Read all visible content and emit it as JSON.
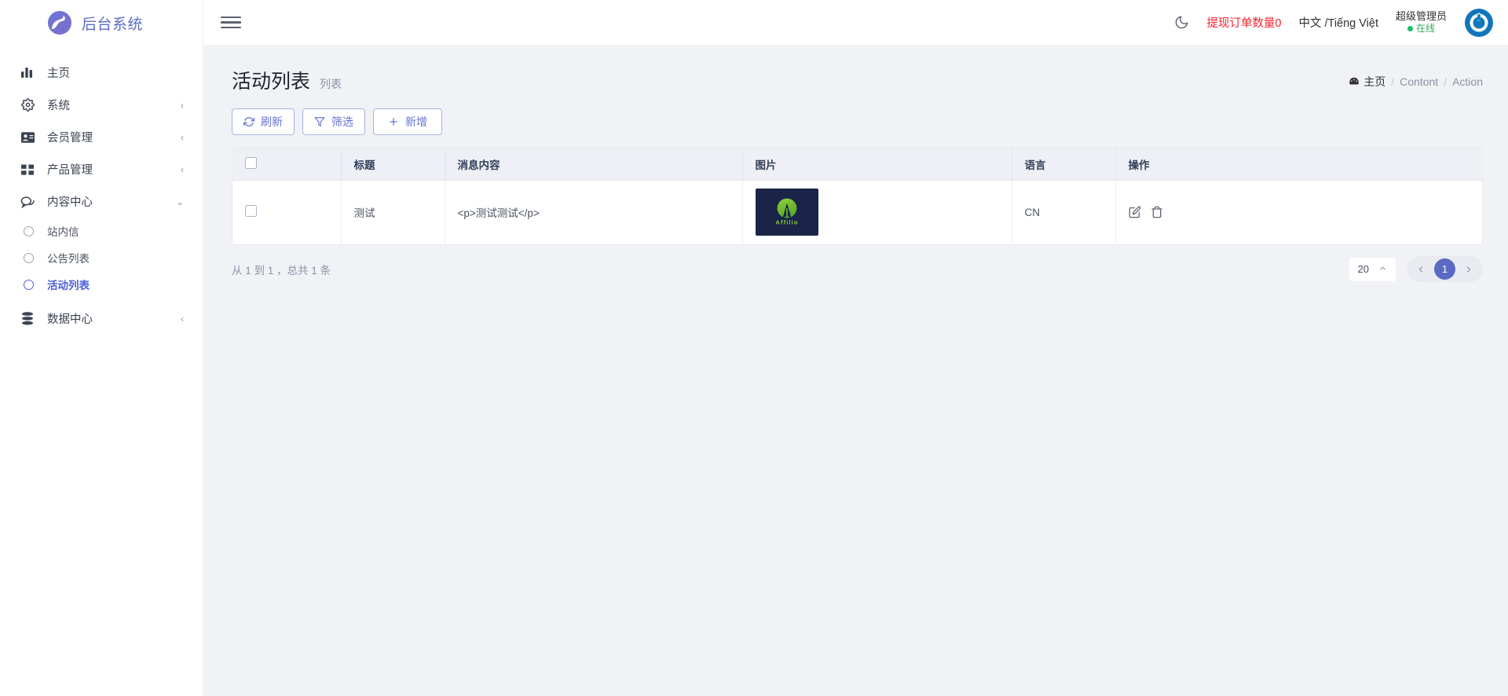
{
  "brand": {
    "title": "后台系统",
    "logo_icon": "swoosh-circle-logo"
  },
  "sidebar": {
    "items": [
      {
        "label": "主页",
        "icon": "bar-chart-icon",
        "arrow": ""
      },
      {
        "label": "系统",
        "icon": "gear-icon",
        "arrow": "‹"
      },
      {
        "label": "会员管理",
        "icon": "id-card-icon",
        "arrow": "‹"
      },
      {
        "label": "产品管理",
        "icon": "grid-icon",
        "arrow": "‹"
      },
      {
        "label": "内容中心",
        "icon": "chat-bubble-icon",
        "arrow": "⌄"
      }
    ],
    "sub_items": [
      {
        "label": "站内信",
        "active": false
      },
      {
        "label": "公告列表",
        "active": false
      },
      {
        "label": "活动列表",
        "active": true
      }
    ],
    "last_item": {
      "label": "数据中心",
      "icon": "database-icon",
      "arrow": "‹"
    }
  },
  "topbar": {
    "menu_icon": "hamburger-icon",
    "theme_icon": "moon-icon",
    "withdraw_label": "提现订单数量0",
    "language_label": "中文 /Tiếng Việt",
    "user_name": "超级管理员",
    "user_status": "在线",
    "avatar_icon": "power-circle-avatar"
  },
  "page": {
    "title": "活动列表",
    "subtitle": "列表",
    "breadcrumb": {
      "home_icon": "dashboard-icon",
      "home": "主页",
      "sep": "/",
      "items": [
        "Contont",
        "Action"
      ]
    }
  },
  "toolbar": {
    "refresh_label": "刷新",
    "refresh_icon": "refresh-icon",
    "filter_label": "筛选",
    "filter_icon": "funnel-icon",
    "add_label": "新增",
    "add_icon": "plus-icon"
  },
  "table": {
    "columns": [
      "",
      "标题",
      "消息内容",
      "图片",
      "语言",
      "操作"
    ],
    "rows": [
      {
        "title": "测试",
        "message": "<p>测试测试</p>",
        "image_alt": "Affilio",
        "image_bg": "#1a2448",
        "image_text": "Affilio",
        "language": "CN",
        "actions": [
          "edit-icon",
          "delete-icon"
        ]
      }
    ]
  },
  "footer": {
    "total_text": "从 1 到 1 ，总共 1 条",
    "page_size": "20",
    "page_size_caret": "⌃",
    "prev_icon": "chevron-left-icon",
    "next_icon": "chevron-right-icon",
    "current_page": "1"
  },
  "colors": {
    "accent": "#5b6ac4",
    "danger": "#f5222d",
    "online": "#19be6b",
    "page_bg": "#f0f2f5",
    "header_bg": "#eef0f5"
  }
}
